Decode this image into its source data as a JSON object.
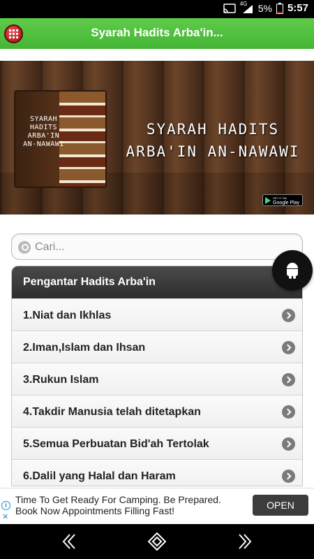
{
  "status_bar": {
    "network_label": "4G",
    "battery_percent": "5%",
    "time": "5:57"
  },
  "app_bar": {
    "title": "Syarah Hadits Arba'in...",
    "app_icon": "grid-menu-icon"
  },
  "banner": {
    "book_cover_text": [
      "SYARAH",
      "HADITS",
      "ARBA'IN",
      "AN-NAWAWI"
    ],
    "title_line1": "SYARAH HADITS",
    "title_line2": "ARBA'IN AN-NAWAWI",
    "store_badge_small": "GET IT ON",
    "store_badge_name": "Google Play"
  },
  "search": {
    "placeholder": "Cari..."
  },
  "list": {
    "header": "Pengantar Hadits Arba'in",
    "items": [
      {
        "label": "1.Niat dan Ikhlas"
      },
      {
        "label": "2.Iman,Islam dan Ihsan"
      },
      {
        "label": "3.Rukun Islam"
      },
      {
        "label": "4.Takdir Manusia telah ditetapkan"
      },
      {
        "label": "5.Semua Perbuatan Bid'ah Tertolak"
      },
      {
        "label": "6.Dalil yang Halal dan Haram"
      }
    ]
  },
  "fab": {
    "icon": "android-icon"
  },
  "ad": {
    "text_line1": "Time To Get Ready For Camping. Be Prepared.",
    "text_line2": "Book Now Appointments Filling Fast!",
    "button_label": "OPEN",
    "info_glyph": "i",
    "close_glyph": "✕"
  },
  "nav_bar": {
    "icons": [
      "back-icon",
      "home-icon",
      "recents-icon"
    ]
  },
  "colors": {
    "app_bar": "#4cba3a",
    "list_header": "#3a3a3a",
    "ad_accent": "#1a8fe0"
  }
}
